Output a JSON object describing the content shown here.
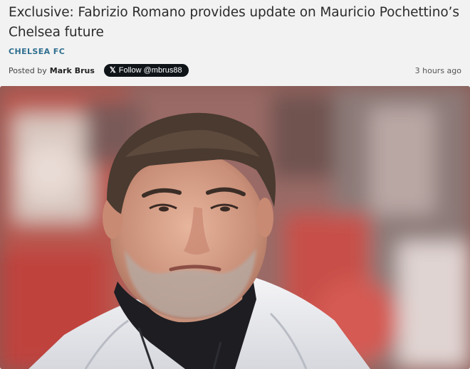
{
  "article": {
    "headline": "Exclusive: Fabrizio Romano provides update on Mauricio Pochettino’s Chelsea future",
    "category": "CHELSEA FC",
    "byline_prefix": "Posted by",
    "author": "Mark Brus",
    "follow_label": "Follow @mbrus88",
    "follow_icon": "x-logo-icon",
    "timestamp": "3 hours ago"
  },
  "colors": {
    "category": "#2f6f8f",
    "follow_button_bg": "#0f1419",
    "page_bg": "#f2f2f2"
  }
}
